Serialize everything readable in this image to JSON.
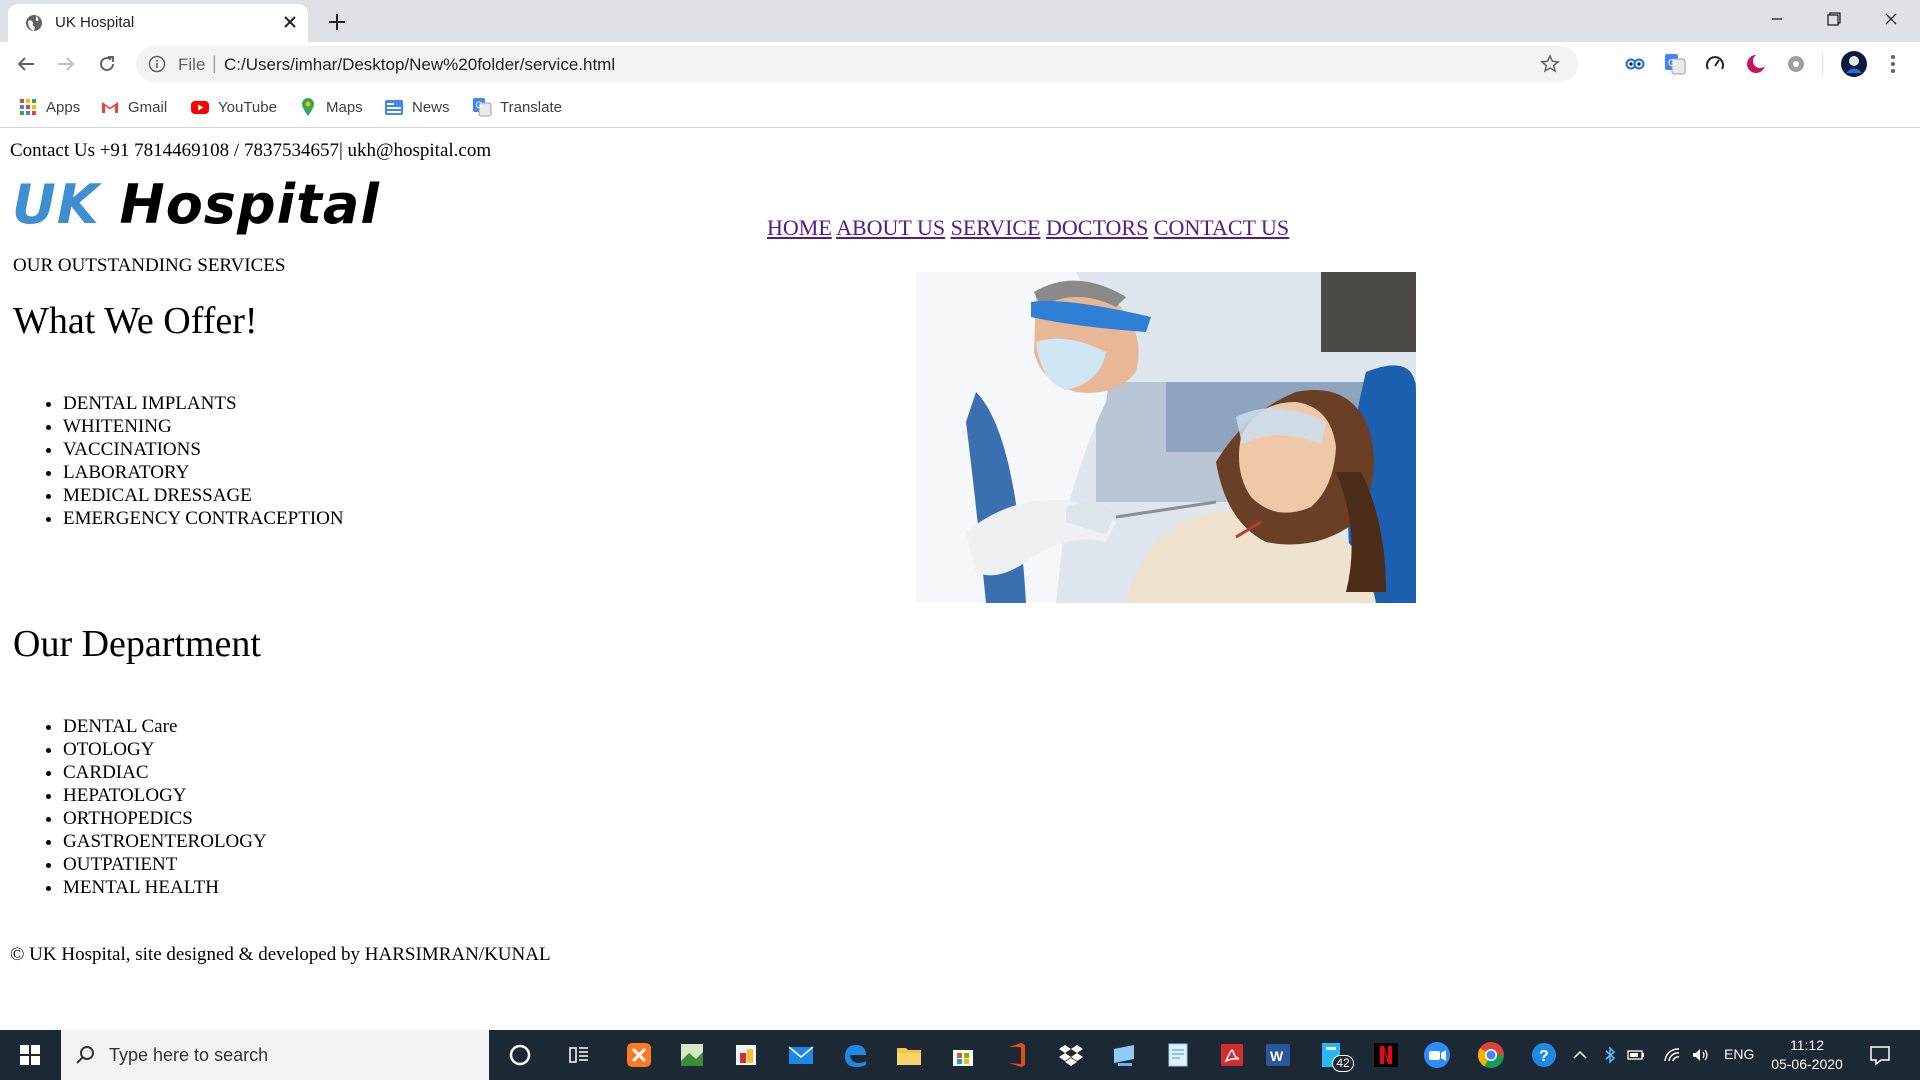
{
  "browser": {
    "tab_title": "UK Hospital",
    "omnibox_scheme": "File",
    "url": "C:/Users/imhar/Desktop/New%20folder/service.html",
    "bookmarks": [
      "Apps",
      "Gmail",
      "YouTube",
      "Maps",
      "News",
      "Translate"
    ]
  },
  "page": {
    "contact": "Contact Us +91 7814469108 / 7837534657| ukh@hospital.com",
    "logo_uk": "UK",
    "logo_hospital": "Hospital",
    "nav": [
      "HOME",
      "ABOUT US",
      "SERVICE",
      "DOCTORS",
      "CONTACT US"
    ],
    "services_label": "OUR OUTSTANDING SERVICES",
    "offer_heading": "What We Offer!",
    "offer_items": [
      "DENTAL IMPLANTS",
      "WHITENING",
      "VACCINATIONS",
      "LABORATORY",
      "MEDICAL DRESSAGE",
      "EMERGENCY CONTRACEPTION"
    ],
    "dept_heading": "Our Department",
    "dept_items": [
      "DENTAL Care",
      "OTOLOGY",
      "CARDIAC",
      "HEPATOLOGY",
      "ORTHOPEDICS",
      "GASTROENTEROLOGY",
      "OUTPATIENT",
      "MENTAL HEALTH"
    ],
    "footer": "© UK Hospital, site designed & developed by HARSIMRAN/KUNAL",
    "photo_desc": "dentist-with-patient-photo"
  },
  "taskbar": {
    "search_placeholder": "Type here to search",
    "dropbox_badge": "42",
    "language": "ENG",
    "time": "11:12",
    "date": "05-06-2020"
  },
  "colors": {
    "logo_blue": "#3d8fd1",
    "visited_link": "#551a8b",
    "tab_strip": "#dee1e6",
    "taskbar": "#1c2833"
  }
}
